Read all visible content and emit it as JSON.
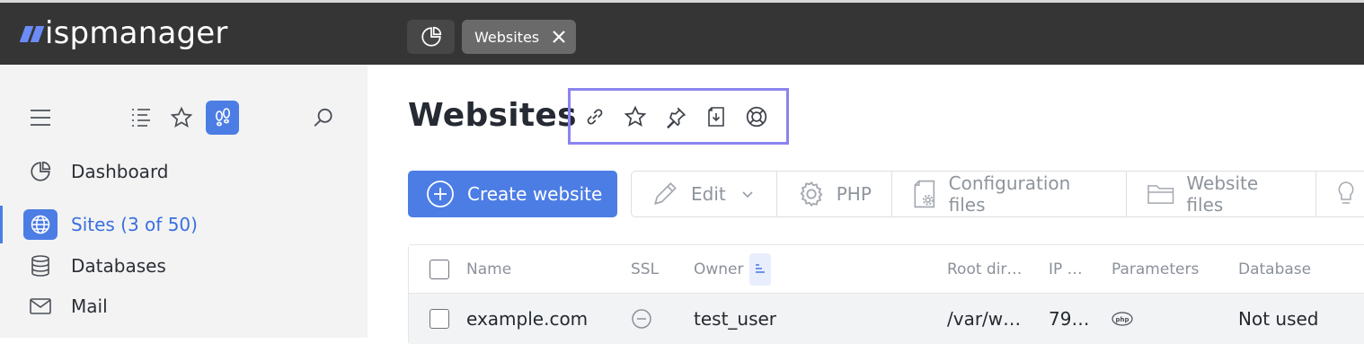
{
  "app": {
    "logo_text": "ispmanager"
  },
  "tabs": [
    {
      "icon": "pie-chart-icon"
    },
    {
      "label": "Websites",
      "close_icon": "close-icon"
    }
  ],
  "sidebar": {
    "tools": [
      "menu-icon",
      "list-icon",
      "star-icon",
      "footprints-icon",
      "search-icon"
    ],
    "items": [
      {
        "label": "Dashboard",
        "icon": "pie-chart-icon"
      },
      {
        "label": "Sites (3 of 50)",
        "icon": "globe-icon",
        "active": true
      },
      {
        "label": "Databases",
        "icon": "database-icon"
      },
      {
        "label": "Mail",
        "icon": "mail-icon"
      }
    ]
  },
  "main": {
    "title": "Websites",
    "title_tools": [
      "link-icon",
      "star-icon",
      "pin-icon",
      "download-doc-icon",
      "help-lifebuoy-icon"
    ],
    "create_label": "Create website",
    "toolbar": [
      {
        "label": "Edit",
        "icon": "pencil-icon"
      },
      {
        "label": "PHP",
        "icon": "gear-icon"
      },
      {
        "label": "Configuration files",
        "icon": "config-file-icon"
      },
      {
        "label": "Website files",
        "icon": "folder-icon"
      }
    ],
    "table": {
      "columns": [
        "Name",
        "SSL",
        "Owner",
        "Root dir…",
        "IP …",
        "Parameters",
        "Database"
      ],
      "rows": [
        {
          "name": "example.com",
          "owner": "test_user",
          "root": "/var/w…",
          "ip": "79…",
          "database": "Not used"
        }
      ]
    }
  },
  "colors": {
    "accent": "#4c7de5",
    "topbar": "#353535",
    "highlight_border": "#8b84ef"
  }
}
